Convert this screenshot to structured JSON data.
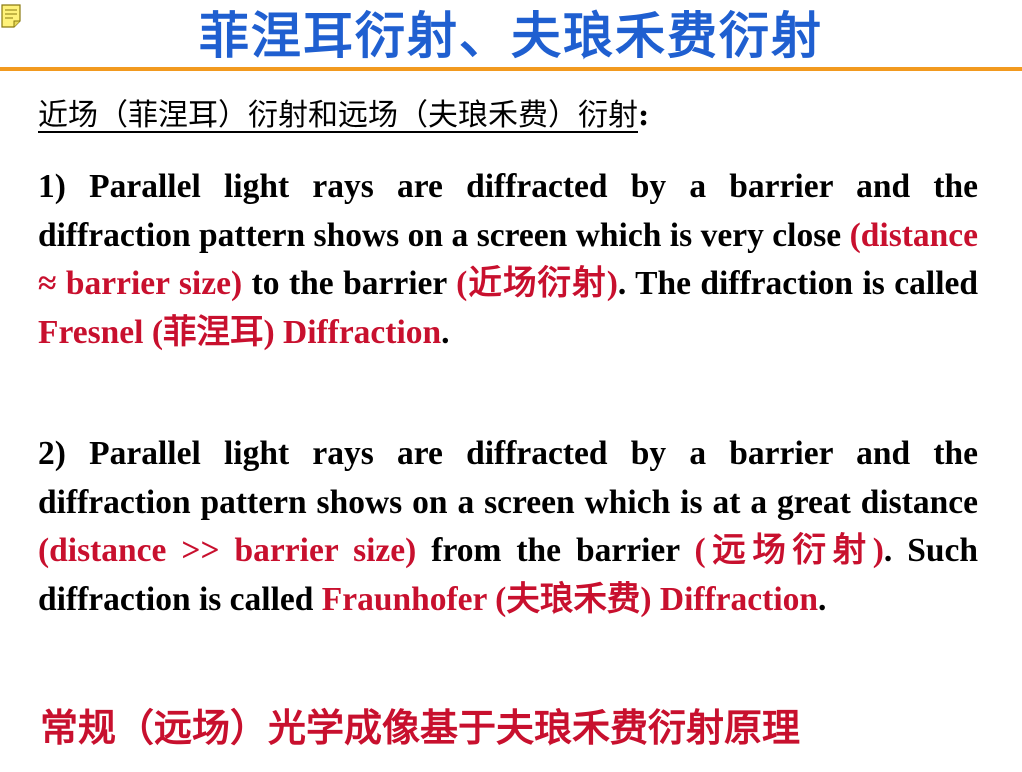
{
  "title": "菲涅耳衍射、夫琅禾费衍射",
  "subtitle": {
    "text": "近场（菲涅耳）衍射和远场（夫琅禾费）衍射",
    "colon": ":"
  },
  "paragraph1": {
    "part1": "1) Parallel light rays are diffracted by a barrier and the diffraction pattern shows on a screen which is very close ",
    "red1": "(distance ≈ barrier size)",
    "part2": " to the barrier ",
    "red2": "(近场衍射)",
    "part3": ". The diffraction is called ",
    "red3": "Fresnel (菲涅耳) Diffraction",
    "part4": "."
  },
  "paragraph2": {
    "part1": "2) Parallel light rays are diffracted by a barrier and the diffraction pattern shows on a screen which is at a great distance ",
    "red1": "(distance >> barrier size)",
    "part2": " from the barrier ",
    "red2": "(远场衍射)",
    "part3": ". Such diffraction is called ",
    "red3": "Fraunhofer (夫琅禾费) Diffraction",
    "part4": "."
  },
  "bottom_text": "常规（远场）光学成像基于夫琅禾费衍射原理",
  "colors": {
    "title_blue": "#1f5fd0",
    "rule_orange": "#f29a1f",
    "accent_red": "#c8102e"
  },
  "icons": {
    "note": "note-icon"
  }
}
